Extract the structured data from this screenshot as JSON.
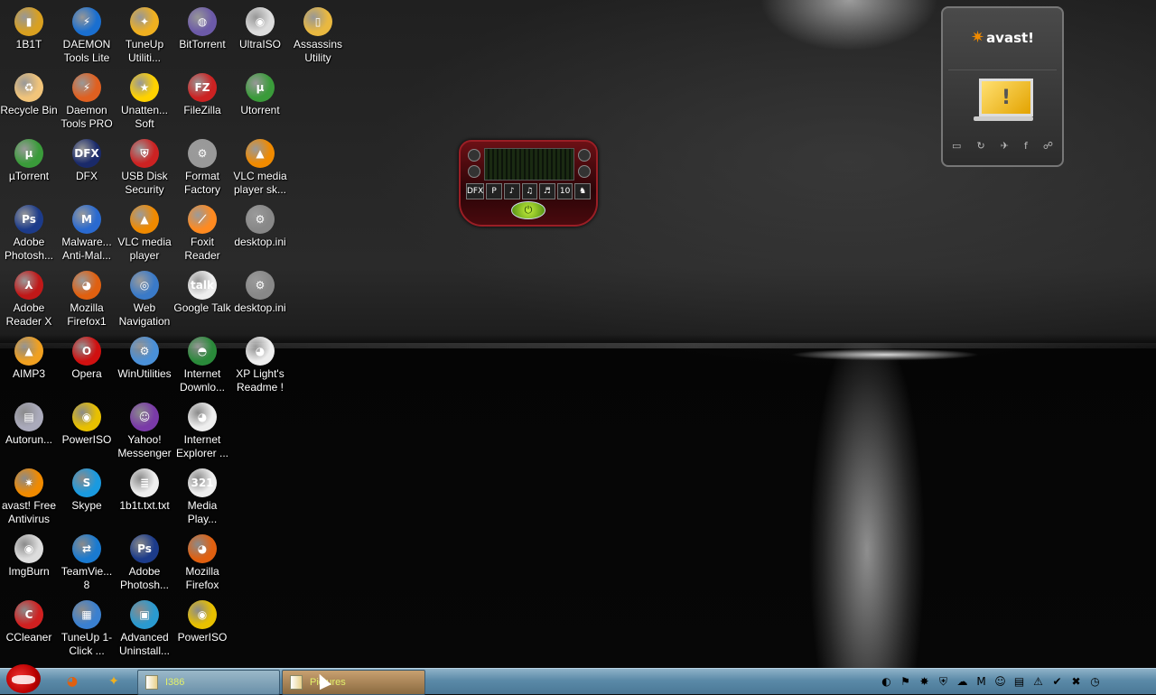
{
  "desktop": {
    "icons": [
      {
        "label": "1B1T",
        "col": 0,
        "row": 0,
        "color": "#d9a020",
        "glyph": "▮"
      },
      {
        "label": "DAEMON Tools Lite",
        "col": 1,
        "row": 0,
        "color": "#1a6fd0",
        "glyph": "⚡"
      },
      {
        "label": "TuneUp Utiliti...",
        "col": 2,
        "row": 0,
        "color": "#f0b020",
        "glyph": "✦"
      },
      {
        "label": "BitTorrent",
        "col": 3,
        "row": 0,
        "color": "#6c5aa8",
        "glyph": "◍"
      },
      {
        "label": "UltraISO",
        "col": 4,
        "row": 0,
        "color": "#ddd",
        "glyph": "◉"
      },
      {
        "label": "Assassins Utility",
        "col": 5,
        "row": 0,
        "color": "#e9b840",
        "glyph": "▯"
      },
      {
        "label": "Recycle Bin",
        "col": 0,
        "row": 1,
        "color": "#f1c47a",
        "glyph": "♻"
      },
      {
        "label": "Daemon Tools PRO",
        "col": 1,
        "row": 1,
        "color": "#e06020",
        "glyph": "⚡"
      },
      {
        "label": "Unatten... Soft",
        "col": 2,
        "row": 1,
        "color": "#ffd200",
        "glyph": "★"
      },
      {
        "label": "FileZilla",
        "col": 3,
        "row": 1,
        "color": "#c22",
        "glyph": "FZ"
      },
      {
        "label": "Utorrent",
        "col": 4,
        "row": 1,
        "color": "#3a9b3a",
        "glyph": "µ"
      },
      {
        "label": "µTorrent",
        "col": 0,
        "row": 2,
        "color": "#3a9b3a",
        "glyph": "µ"
      },
      {
        "label": "DFX",
        "col": 1,
        "row": 2,
        "color": "#1a2a6a",
        "glyph": "DFX"
      },
      {
        "label": "USB Disk Security",
        "col": 2,
        "row": 2,
        "color": "#c22",
        "glyph": "⛨"
      },
      {
        "label": "Format Factory",
        "col": 3,
        "row": 2,
        "color": "#999",
        "glyph": "⚙"
      },
      {
        "label": "VLC media player sk...",
        "col": 4,
        "row": 2,
        "color": "#f08a00",
        "glyph": "▲"
      },
      {
        "label": "Adobe Photosh...",
        "col": 0,
        "row": 3,
        "color": "#1c3b8a",
        "glyph": "Ps"
      },
      {
        "label": "Malware... Anti-Mal...",
        "col": 1,
        "row": 3,
        "color": "#2a6ad0",
        "glyph": "M"
      },
      {
        "label": "VLC media player",
        "col": 2,
        "row": 3,
        "color": "#f08a00",
        "glyph": "▲"
      },
      {
        "label": "Foxit Reader",
        "col": 3,
        "row": 3,
        "color": "#ff8a20",
        "glyph": "⟋"
      },
      {
        "label": "desktop.ini",
        "col": 4,
        "row": 3,
        "color": "#888",
        "glyph": "⚙"
      },
      {
        "label": "Adobe Reader X",
        "col": 0,
        "row": 4,
        "color": "#c01818",
        "glyph": "⅄"
      },
      {
        "label": "Mozilla Firefox1",
        "col": 1,
        "row": 4,
        "color": "#e06010",
        "glyph": "◕"
      },
      {
        "label": "Web Navigation",
        "col": 2,
        "row": 4,
        "color": "#3a7ac8",
        "glyph": "◎"
      },
      {
        "label": "Google Talk",
        "col": 3,
        "row": 4,
        "color": "#eee",
        "glyph": "talk"
      },
      {
        "label": "desktop.ini",
        "col": 4,
        "row": 4,
        "color": "#888",
        "glyph": "⚙"
      },
      {
        "label": "AIMP3",
        "col": 0,
        "row": 5,
        "color": "#f0a020",
        "glyph": "▲"
      },
      {
        "label": "Opera",
        "col": 1,
        "row": 5,
        "color": "#d01010",
        "glyph": "O"
      },
      {
        "label": "WinUtilities",
        "col": 2,
        "row": 5,
        "color": "#4a90d8",
        "glyph": "⚙"
      },
      {
        "label": "Internet Downlo...",
        "col": 3,
        "row": 5,
        "color": "#2a8a3a",
        "glyph": "◓"
      },
      {
        "label": "XP Light's Readme !",
        "col": 4,
        "row": 5,
        "color": "#eee",
        "glyph": "◕"
      },
      {
        "label": "Autorun...",
        "col": 0,
        "row": 6,
        "color": "#aab",
        "glyph": "▤"
      },
      {
        "label": "PowerISO",
        "col": 1,
        "row": 6,
        "color": "#e8c000",
        "glyph": "◉"
      },
      {
        "label": "Yahoo! Messenger",
        "col": 2,
        "row": 6,
        "color": "#7a3aa8",
        "glyph": "☺"
      },
      {
        "label": "Internet Explorer ...",
        "col": 3,
        "row": 6,
        "color": "#eee",
        "glyph": "◕"
      },
      {
        "label": "avast! Free Antivirus",
        "col": 0,
        "row": 7,
        "color": "#f08a00",
        "glyph": "✷"
      },
      {
        "label": "Skype",
        "col": 1,
        "row": 7,
        "color": "#1a9ae0",
        "glyph": "S"
      },
      {
        "label": "1b1t.txt.txt",
        "col": 2,
        "row": 7,
        "color": "#eee",
        "glyph": "≣"
      },
      {
        "label": "Media Play...",
        "col": 3,
        "row": 7,
        "color": "#eee",
        "glyph": "321"
      },
      {
        "label": "ImgBurn",
        "col": 0,
        "row": 8,
        "color": "#ddd",
        "glyph": "◉"
      },
      {
        "label": "TeamVie... 8",
        "col": 1,
        "row": 8,
        "color": "#1a7ad0",
        "glyph": "⇄"
      },
      {
        "label": "Adobe Photosh...",
        "col": 2,
        "row": 8,
        "color": "#1c3b8a",
        "glyph": "Ps"
      },
      {
        "label": "Mozilla Firefox",
        "col": 3,
        "row": 8,
        "color": "#e06010",
        "glyph": "◕"
      },
      {
        "label": "CCleaner",
        "col": 0,
        "row": 9,
        "color": "#d02020",
        "glyph": "C"
      },
      {
        "label": "TuneUp 1-Click ...",
        "col": 1,
        "row": 9,
        "color": "#3a80d0",
        "glyph": "▦"
      },
      {
        "label": "Advanced Uninstall...",
        "col": 2,
        "row": 9,
        "color": "#2a9ad0",
        "glyph": "▣"
      },
      {
        "label": "PowerISO",
        "col": 3,
        "row": 9,
        "color": "#e8c000",
        "glyph": "◉"
      }
    ]
  },
  "dfx_widget": {
    "buttons": [
      "DFX",
      "P",
      "♪",
      "♫",
      "♬",
      "10",
      "♞"
    ],
    "power_glyph": "⏻"
  },
  "avast_gadget": {
    "logo": "avast!",
    "status_glyph": "!",
    "tools": [
      "▭",
      "↻",
      "✈",
      "f",
      "☍"
    ]
  },
  "taskbar": {
    "quicklaunch": [
      {
        "name": "firefox-icon",
        "glyph": "◕",
        "color": "#e06010"
      },
      {
        "name": "tuneup-icon",
        "glyph": "✦",
        "color": "#f0b020"
      }
    ],
    "tasks": [
      {
        "label": "I386"
      },
      {
        "label": "Pictures"
      }
    ],
    "tray": [
      "◐",
      "⚑",
      "✸",
      "⛨",
      "☁",
      "M",
      "☺",
      "▤",
      "⚠",
      "✔",
      "✖",
      "◷"
    ]
  }
}
